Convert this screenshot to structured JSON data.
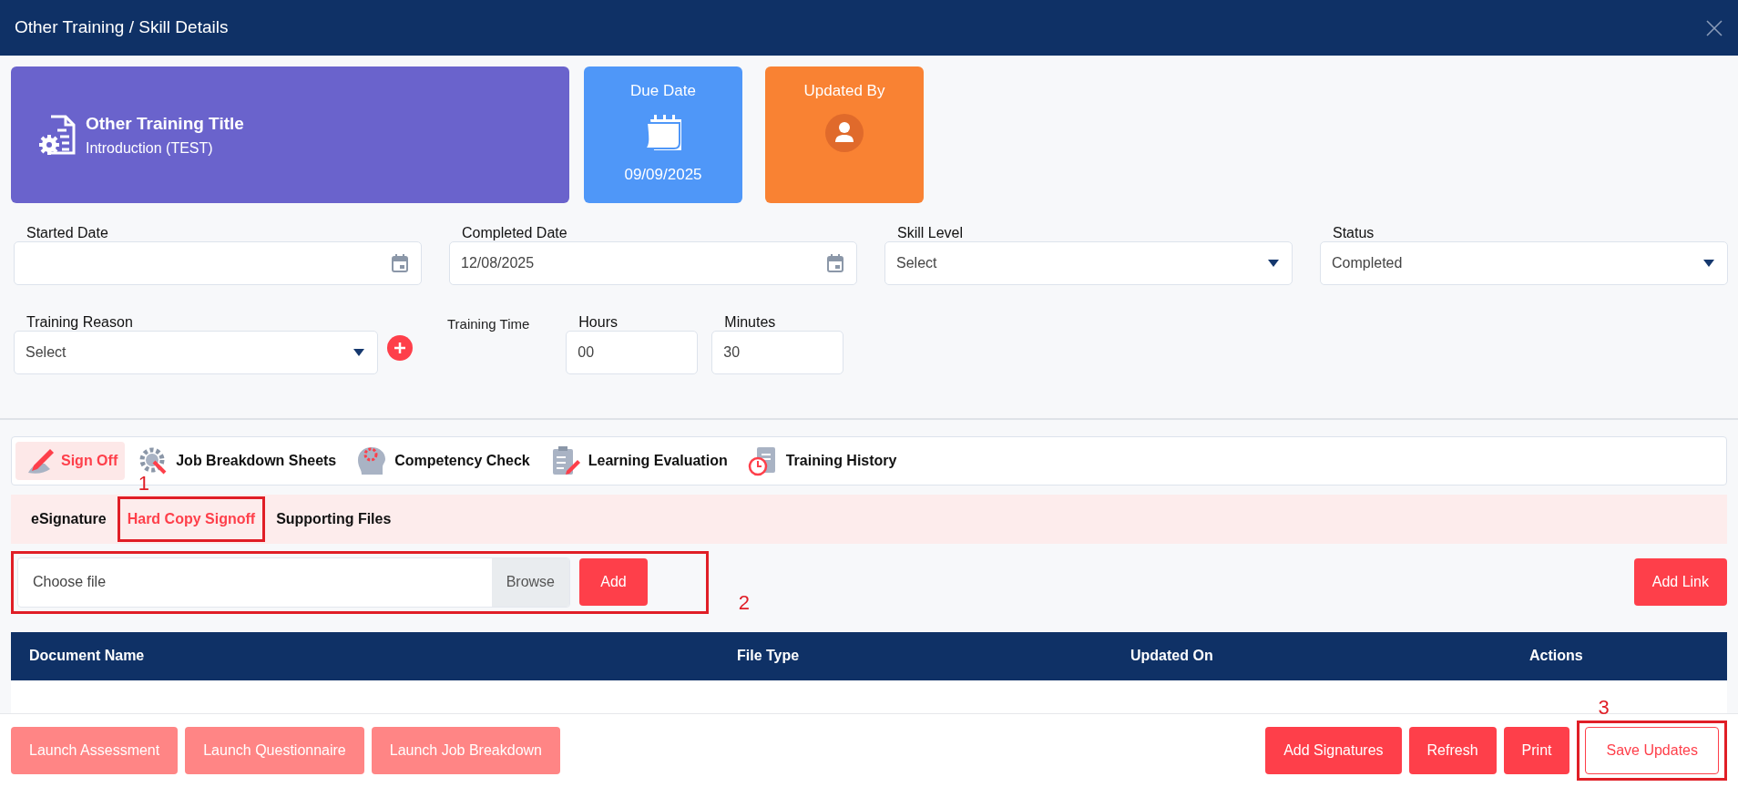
{
  "window": {
    "title": "Other Training / Skill Details"
  },
  "summary_cards": [
    {
      "kind": "title",
      "heading": "Other Training Title",
      "value": "Introduction (TEST)",
      "color": "#6a63cc"
    },
    {
      "kind": "date",
      "heading": "Due Date",
      "value": "09/09/2025",
      "color": "#4f97f8"
    },
    {
      "kind": "user",
      "heading": "Updated By",
      "color": "#f98233"
    }
  ],
  "fields": [
    {
      "kind": "date",
      "label": "Started Date"
    },
    {
      "kind": "date",
      "label": "Completed Date",
      "value": "12/08/2025"
    },
    {
      "kind": "select",
      "label": "Skill Level",
      "value": "Select"
    },
    {
      "kind": "select",
      "label": "Status",
      "value": "Completed"
    }
  ],
  "training_reason": {
    "label": "Training Reason",
    "value": "Select"
  },
  "training_time": {
    "label": "Training Time",
    "hours": {
      "label": "Hours",
      "value": "00"
    },
    "minutes": {
      "label": "Minutes",
      "value": "30"
    }
  },
  "tabs": [
    {
      "label": "Sign Off",
      "selected": true
    },
    {
      "label": "Job Breakdown Sheets",
      "selected": false
    },
    {
      "label": "Competency Check",
      "selected": false
    },
    {
      "label": "Learning Evaluation",
      "selected": false
    },
    {
      "label": "Training History",
      "selected": false
    }
  ],
  "subtabs": [
    {
      "label": "eSignature",
      "selected": false
    },
    {
      "label": "Hard Copy Signoff",
      "selected": true,
      "callout": "1"
    },
    {
      "label": "Supporting Files",
      "selected": false
    }
  ],
  "upload": {
    "placeholder": "Choose file",
    "browse": "Browse",
    "add": "Add",
    "callout": "2"
  },
  "add_link": "Add Link",
  "table": {
    "columns": [
      "Document Name",
      "File Type",
      "Updated On",
      "Actions"
    ]
  },
  "footer": {
    "left_buttons": [
      {
        "label": "Launch Assessment",
        "disabled": true
      },
      {
        "label": "Launch Questionnaire",
        "disabled": true
      },
      {
        "label": "Launch Job Breakdown",
        "disabled": true
      }
    ],
    "right_buttons": [
      {
        "label": "Add Signatures",
        "kind": "solid"
      },
      {
        "label": "Refresh",
        "kind": "solid"
      },
      {
        "label": "Print",
        "kind": "solid"
      },
      {
        "label": "Save Updates",
        "kind": "outline",
        "callout": "3"
      }
    ]
  }
}
